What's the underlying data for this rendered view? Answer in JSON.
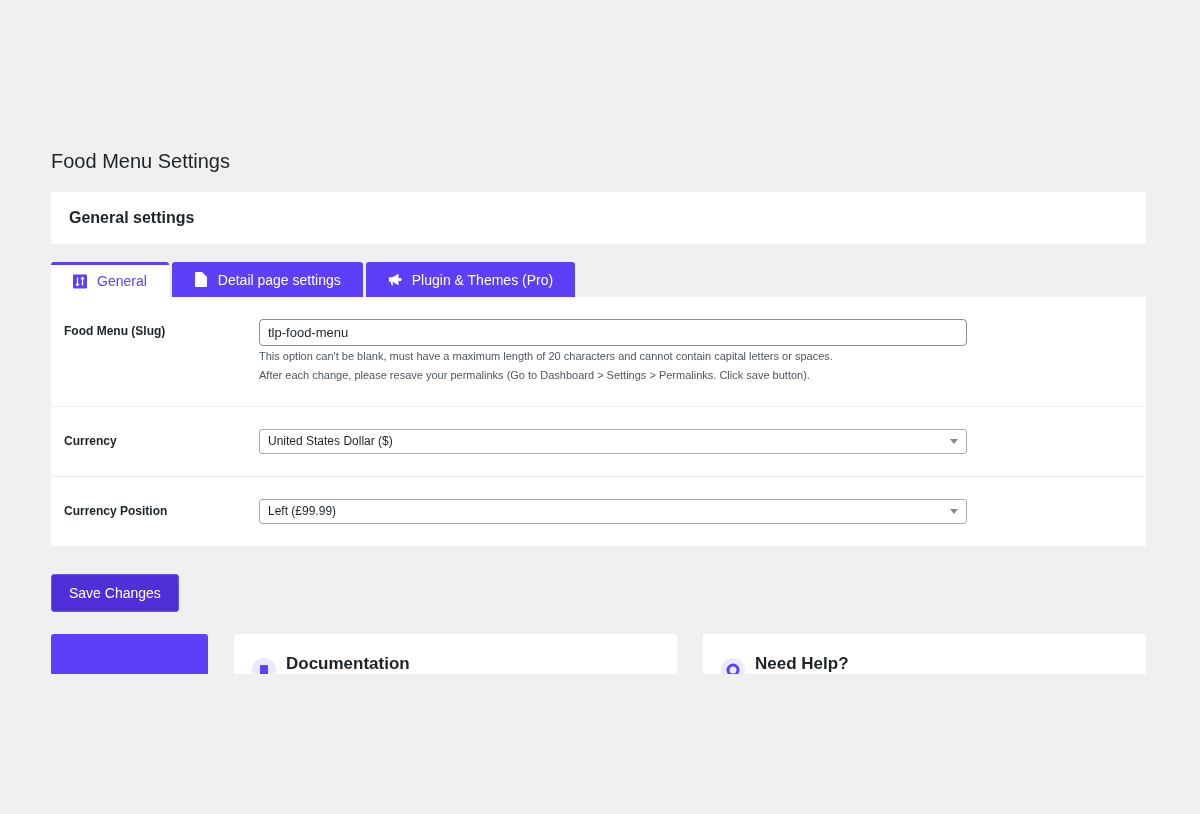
{
  "page_title": "Food Menu Settings",
  "section_header": "General settings",
  "tabs": [
    {
      "label": "General",
      "selected": true
    },
    {
      "label": "Detail page settings",
      "selected": false
    },
    {
      "label": "Plugin & Themes (Pro)",
      "selected": false
    }
  ],
  "fields": [
    {
      "label": "Food Menu (Slug)",
      "kind": "text",
      "value": "tlp-food-menu",
      "help": [
        "This option can't be blank, must have a maximum length of 20 characters and cannot contain capital letters or spaces.",
        "After each change, please resave your permalinks (Go to Dashboard > Settings > Permalinks. Click save button)."
      ]
    },
    {
      "label": "Currency",
      "kind": "select",
      "value": "United States Dollar ($)"
    },
    {
      "label": "Currency Position",
      "kind": "select",
      "value": "Left (£99.99)"
    }
  ],
  "save_button": "Save Changes",
  "cards": [
    {
      "title": "Documentation"
    },
    {
      "title": "Need Help?"
    }
  ]
}
